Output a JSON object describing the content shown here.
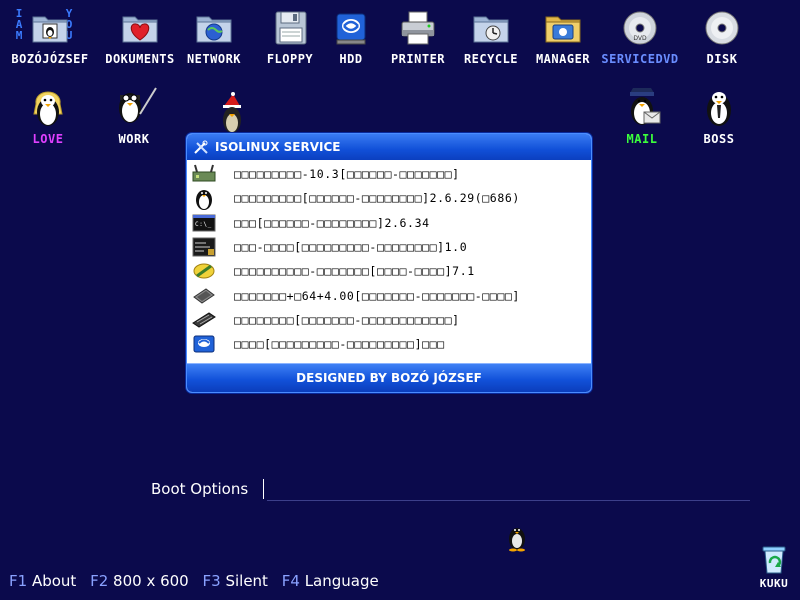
{
  "colors": {
    "background": "#0b0a4c",
    "label_white": "#ffffff",
    "label_magenta": "#e040ff",
    "label_green": "#3cff3c",
    "label_blue": "#6a8dff",
    "dialog_blue": "#1150d8"
  },
  "corner_text": {
    "left": "IAM",
    "right": "YOU"
  },
  "top_icons": [
    {
      "label": "BOZÓJÓZSEF",
      "icon": "user-folder-icon"
    },
    {
      "label": "DOKUMENTS",
      "icon": "heart-folder-icon"
    },
    {
      "label": "NETWORK",
      "icon": "network-folder-icon"
    },
    {
      "label": "FLOPPY",
      "icon": "floppy-icon"
    },
    {
      "label": "HDD",
      "icon": "hdd-icon"
    },
    {
      "label": "PRINTER",
      "icon": "printer-icon"
    },
    {
      "label": "RECYCLE",
      "icon": "recycle-folder-icon"
    },
    {
      "label": "MANAGER",
      "icon": "manager-folder-icon"
    },
    {
      "label": "SERVICEDVD",
      "icon": "dvd-icon"
    },
    {
      "label": "DISK",
      "icon": "cd-icon"
    }
  ],
  "row2_icons": [
    {
      "label": "LOVE",
      "icon": "tux-blonde-icon"
    },
    {
      "label": "WORK",
      "icon": "tux-work-icon"
    },
    {
      "label": "",
      "icon": "tux-santa-icon"
    },
    {
      "label": "MAIL",
      "icon": "tux-mail-icon"
    },
    {
      "label": "BOSS",
      "icon": "tux-boss-icon"
    }
  ],
  "dialog": {
    "title": "ISOLINUX SERVICE",
    "items": [
      {
        "label": "□□□□□□□□□-10.3[□□□□□□-□□□□□□□]",
        "icon": "router-icon"
      },
      {
        "label": "□□□□□□□□□[□□□□□□-□□□□□□□□]2.6.29(□686)",
        "icon": "tux-icon"
      },
      {
        "label": "□□□[□□□□□□-□□□□□□□□]2.6.34",
        "icon": "terminal-icon"
      },
      {
        "label": "□□□-□□□□[□□□□□□□□□-□□□□□□□□]1.0",
        "icon": "console-lock-icon"
      },
      {
        "label": "□□□□□□□□□□-□□□□□□□[□□□□-□□□□]7.1",
        "icon": "wrench-icon"
      },
      {
        "label": "□□□□□□□+□64+4.00[□□□□□□□-□□□□□□□-□□□□]",
        "icon": "memory-chip-icon"
      },
      {
        "label": "□□□□□□□□[□□□□□□□-□□□□□□□□□□□□]",
        "icon": "ram-icon"
      },
      {
        "label": "□□□□[□□□□□□□□□-□□□□□□□□□]□□□",
        "icon": "hdd-small-icon"
      }
    ],
    "footer": "DESIGNED BY BOZÓ JÓZSEF"
  },
  "boot": {
    "label": "Boot Options",
    "value": ""
  },
  "fkeys": [
    {
      "key": "F1",
      "label": "About"
    },
    {
      "key": "F2",
      "label": "800 x 600"
    },
    {
      "key": "F3",
      "label": "Silent"
    },
    {
      "key": "F4",
      "label": "Language"
    }
  ],
  "trash": {
    "label": "KUKU",
    "icon": "recycle-bin-icon"
  }
}
